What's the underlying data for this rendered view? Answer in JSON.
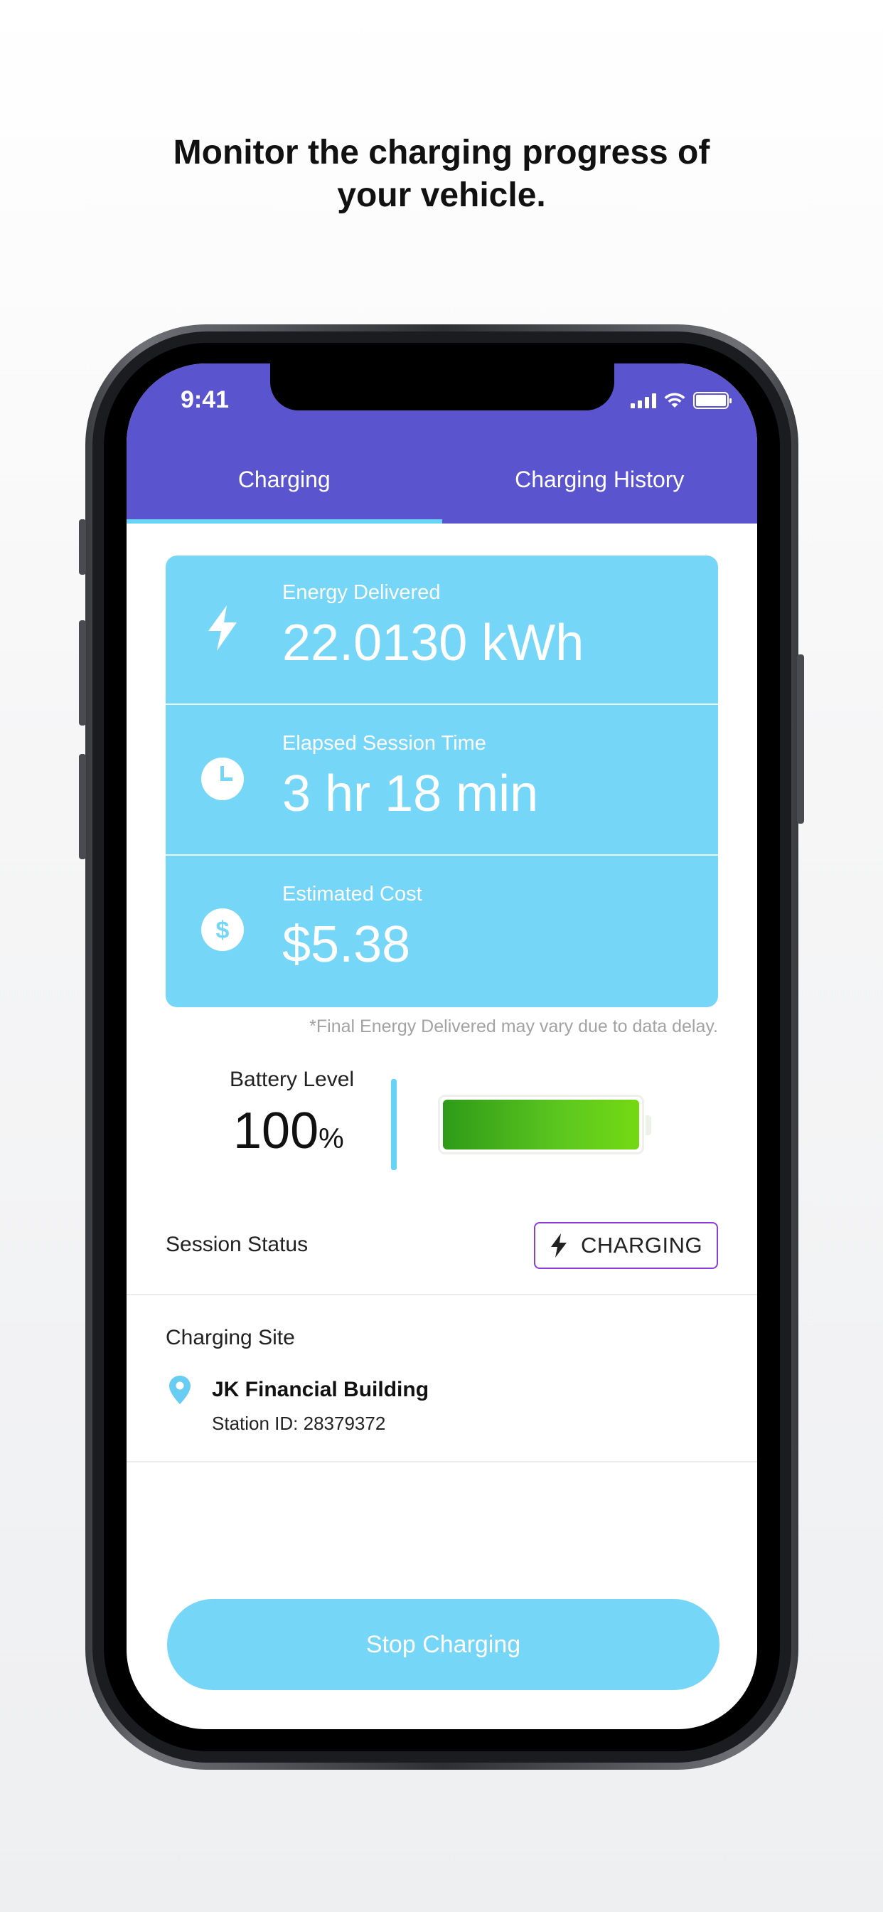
{
  "headline": {
    "line1": "Monitor the charging progress of",
    "line2": "your vehicle."
  },
  "status_bar": {
    "time": "9:41",
    "icons": [
      "signal-icon",
      "wifi-icon",
      "battery-icon"
    ]
  },
  "tabs": [
    {
      "label": "Charging",
      "active": true
    },
    {
      "label": "Charging History",
      "active": false
    }
  ],
  "stats": [
    {
      "icon": "lightning-icon",
      "label": "Energy Delivered",
      "value": "22.0130 kWh"
    },
    {
      "icon": "clock-icon",
      "label": "Elapsed Session Time",
      "value": "3 hr 18 min"
    },
    {
      "icon": "dollar-icon",
      "label": "Estimated Cost",
      "value": "$5.38"
    }
  ],
  "disclaimer": "*Final Energy Delivered may vary due to data delay.",
  "battery": {
    "label": "Battery Level",
    "value": "100",
    "unit": "%",
    "fill_fraction": 1.0
  },
  "session": {
    "label": "Session Status",
    "status": "CHARGING"
  },
  "site": {
    "label": "Charging Site",
    "name": "JK Financial Building",
    "station_id": "Station ID: 28379372"
  },
  "stop_button": "Stop Charging",
  "colors": {
    "header_purple": "#5b54cf",
    "accent_blue": "#76d6f8",
    "badge_border": "#8c3ed6",
    "battery_green": "#5cc71f"
  }
}
